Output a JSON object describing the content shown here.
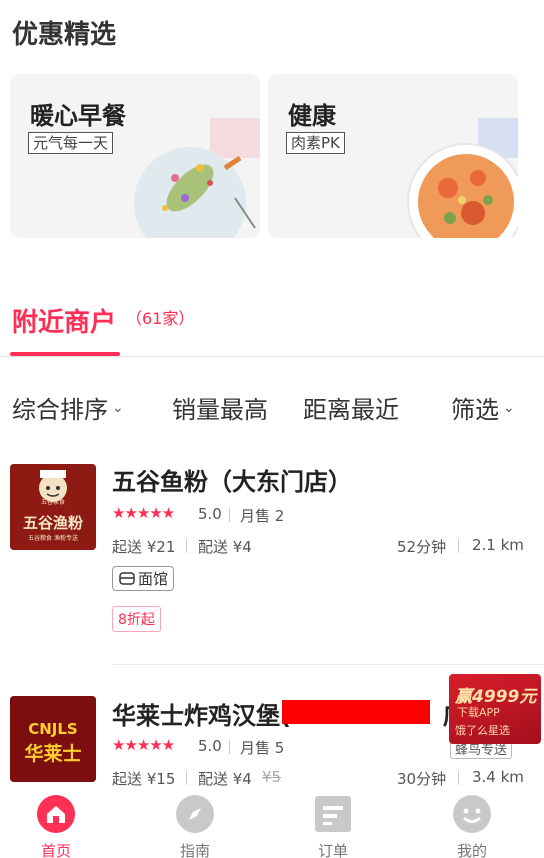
{
  "featured": {
    "title": "优惠精选",
    "cards": [
      {
        "title": "暖心早餐",
        "tag": "元气每一天"
      },
      {
        "title": "健康",
        "tag": "肉素PK"
      }
    ]
  },
  "nearby": {
    "title": "附近商户",
    "count": "（61家）"
  },
  "filters": {
    "sort": "综合排序",
    "sales": "销量最高",
    "distance": "距离最近",
    "filter": "筛选"
  },
  "shops": [
    {
      "name": "五谷鱼粉（大东门店）",
      "stars": "★★★★★",
      "rating": "5.0",
      "monthly_sales": "月售 2",
      "min_order": "起送 ¥21",
      "delivery_fee": "配送 ¥4",
      "time": "52分钟",
      "distance": "2.1 km",
      "category": "面馆",
      "discount": "8折起",
      "logo_text_top": "五谷家食",
      "logo_text_main": "五谷渔粉",
      "logo_text_sub": "五谷粮食 渔粉专送"
    },
    {
      "name": "华莱士炸鸡汉堡(",
      "name_tail": "店)",
      "stars": "★★★★★",
      "rating": "5.0",
      "monthly_sales": "月售 5",
      "min_order": "起送 ¥15",
      "delivery_fee": "配送 ¥4",
      "original_fee": "¥5",
      "time": "30分钟",
      "distance": "3.4 km",
      "delivery_badge": "蜂鸟专送",
      "logo_text_top": "CNJLS",
      "logo_text_main": "华莱士"
    }
  ],
  "ad": {
    "line1": "赢4999元",
    "line2": "下载APP",
    "line3": "饿了么星选"
  },
  "tabbar": [
    {
      "label": "首页",
      "icon": "home-icon",
      "active": true
    },
    {
      "label": "指南",
      "icon": "compass-icon",
      "active": false
    },
    {
      "label": "订单",
      "icon": "order-icon",
      "active": false
    },
    {
      "label": "我的",
      "icon": "profile-icon",
      "active": false
    }
  ],
  "colors": {
    "accent": "#ff2f55",
    "ad_red": "#d81e2c"
  }
}
